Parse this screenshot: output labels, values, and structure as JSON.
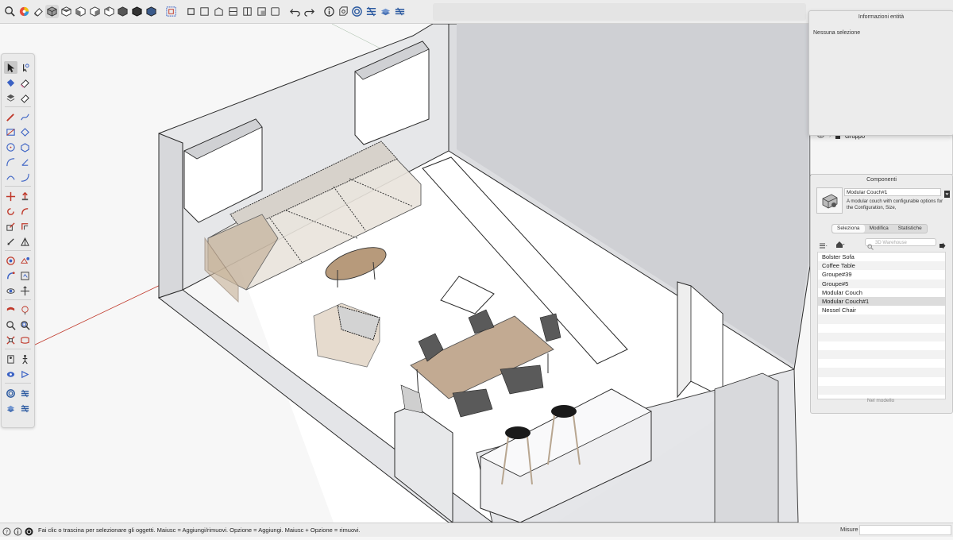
{
  "top_toolbar": {
    "icons": [
      "search-icon",
      "color-wheel-icon",
      "eraser-icon",
      "iso-view-icon",
      "top-view-icon",
      "front-view-icon",
      "right-view-icon",
      "back-view-icon",
      "left-view-icon",
      "bottom-view-icon",
      "section-plane-icon",
      "scale-icon",
      "outer-shell-icon",
      "intersect-icon",
      "union-icon",
      "subtract-icon",
      "trim-icon",
      "split-icon",
      "undo-icon",
      "redo-icon",
      "info-icon",
      "warehouse-icon",
      "extension-icon",
      "sandbox-icon",
      "layers-icon"
    ]
  },
  "left_palette": {
    "tools": [
      "select-tool-icon",
      "lasso-tool-icon",
      "paint-bucket-icon",
      "eraser-tool-icon",
      "tag-tool-icon",
      "eraser-2-icon",
      "pencil-icon",
      "freehand-icon",
      "rectangle-icon",
      "rotated-rectangle-icon",
      "circle-icon",
      "polygon-icon",
      "arc-icon",
      "pie-icon",
      "two-point-arc-icon",
      "three-point-arc-icon",
      "move-icon",
      "push-pull-icon",
      "rotate-icon",
      "follow-me-icon",
      "scale-tool-icon",
      "offset-icon",
      "tape-measure-icon",
      "protractor-icon",
      "dimension-icon",
      "text-icon",
      "axes-icon",
      "3d-text-icon",
      "orbit-icon",
      "pan-icon",
      "zoom-icon",
      "zoom-window-icon",
      "zoom-extents-icon",
      "previous-view-icon",
      "position-camera-icon",
      "walk-icon",
      "look-around-icon",
      "section-icon",
      "warehouse-icon",
      "extension-warehouse-icon",
      "sandbox-from-contours-icon",
      "sandbox-smoove-icon"
    ]
  },
  "entity_panel": {
    "title": "Informazioni entità",
    "no_selection": "Nessuna selezione"
  },
  "outliner": {
    "row_label": "Gruppo"
  },
  "components_panel": {
    "title": "Componenti",
    "component_name": "Modular Couch#1",
    "description": "A modular couch with configurable options for the Configuration, Size,",
    "tabs": [
      {
        "label": "Seleziona",
        "active": true
      },
      {
        "label": "Modifica",
        "active": false
      },
      {
        "label": "Statistiche",
        "active": false
      }
    ],
    "search_placeholder": "3D Warehouse",
    "items": [
      "Bolster Sofa",
      "Coffee Table",
      "Groupe#39",
      "Groupe#5",
      "Modular Couch",
      "Modular Couch#1",
      "Nessel Chair"
    ],
    "selected_item": "Modular Couch#1",
    "footer": "Nel modello"
  },
  "status_bar": {
    "message": "Fai clic o trascina per selezionare gli oggetti. Maiusc = Aggiungi/rimuovi. Opzione = Aggiungi. Maiusc + Opzione = rimuovi.",
    "measure_label": "Misure",
    "measure_value": ""
  },
  "colors": {
    "wall_face": "#e3e4e6",
    "wall_edge": "#2a2a2a",
    "floor": "#ffffff",
    "axis_red": "#c0392b",
    "axis_blue": "#2e5aa8",
    "wood": "#b7a089"
  }
}
